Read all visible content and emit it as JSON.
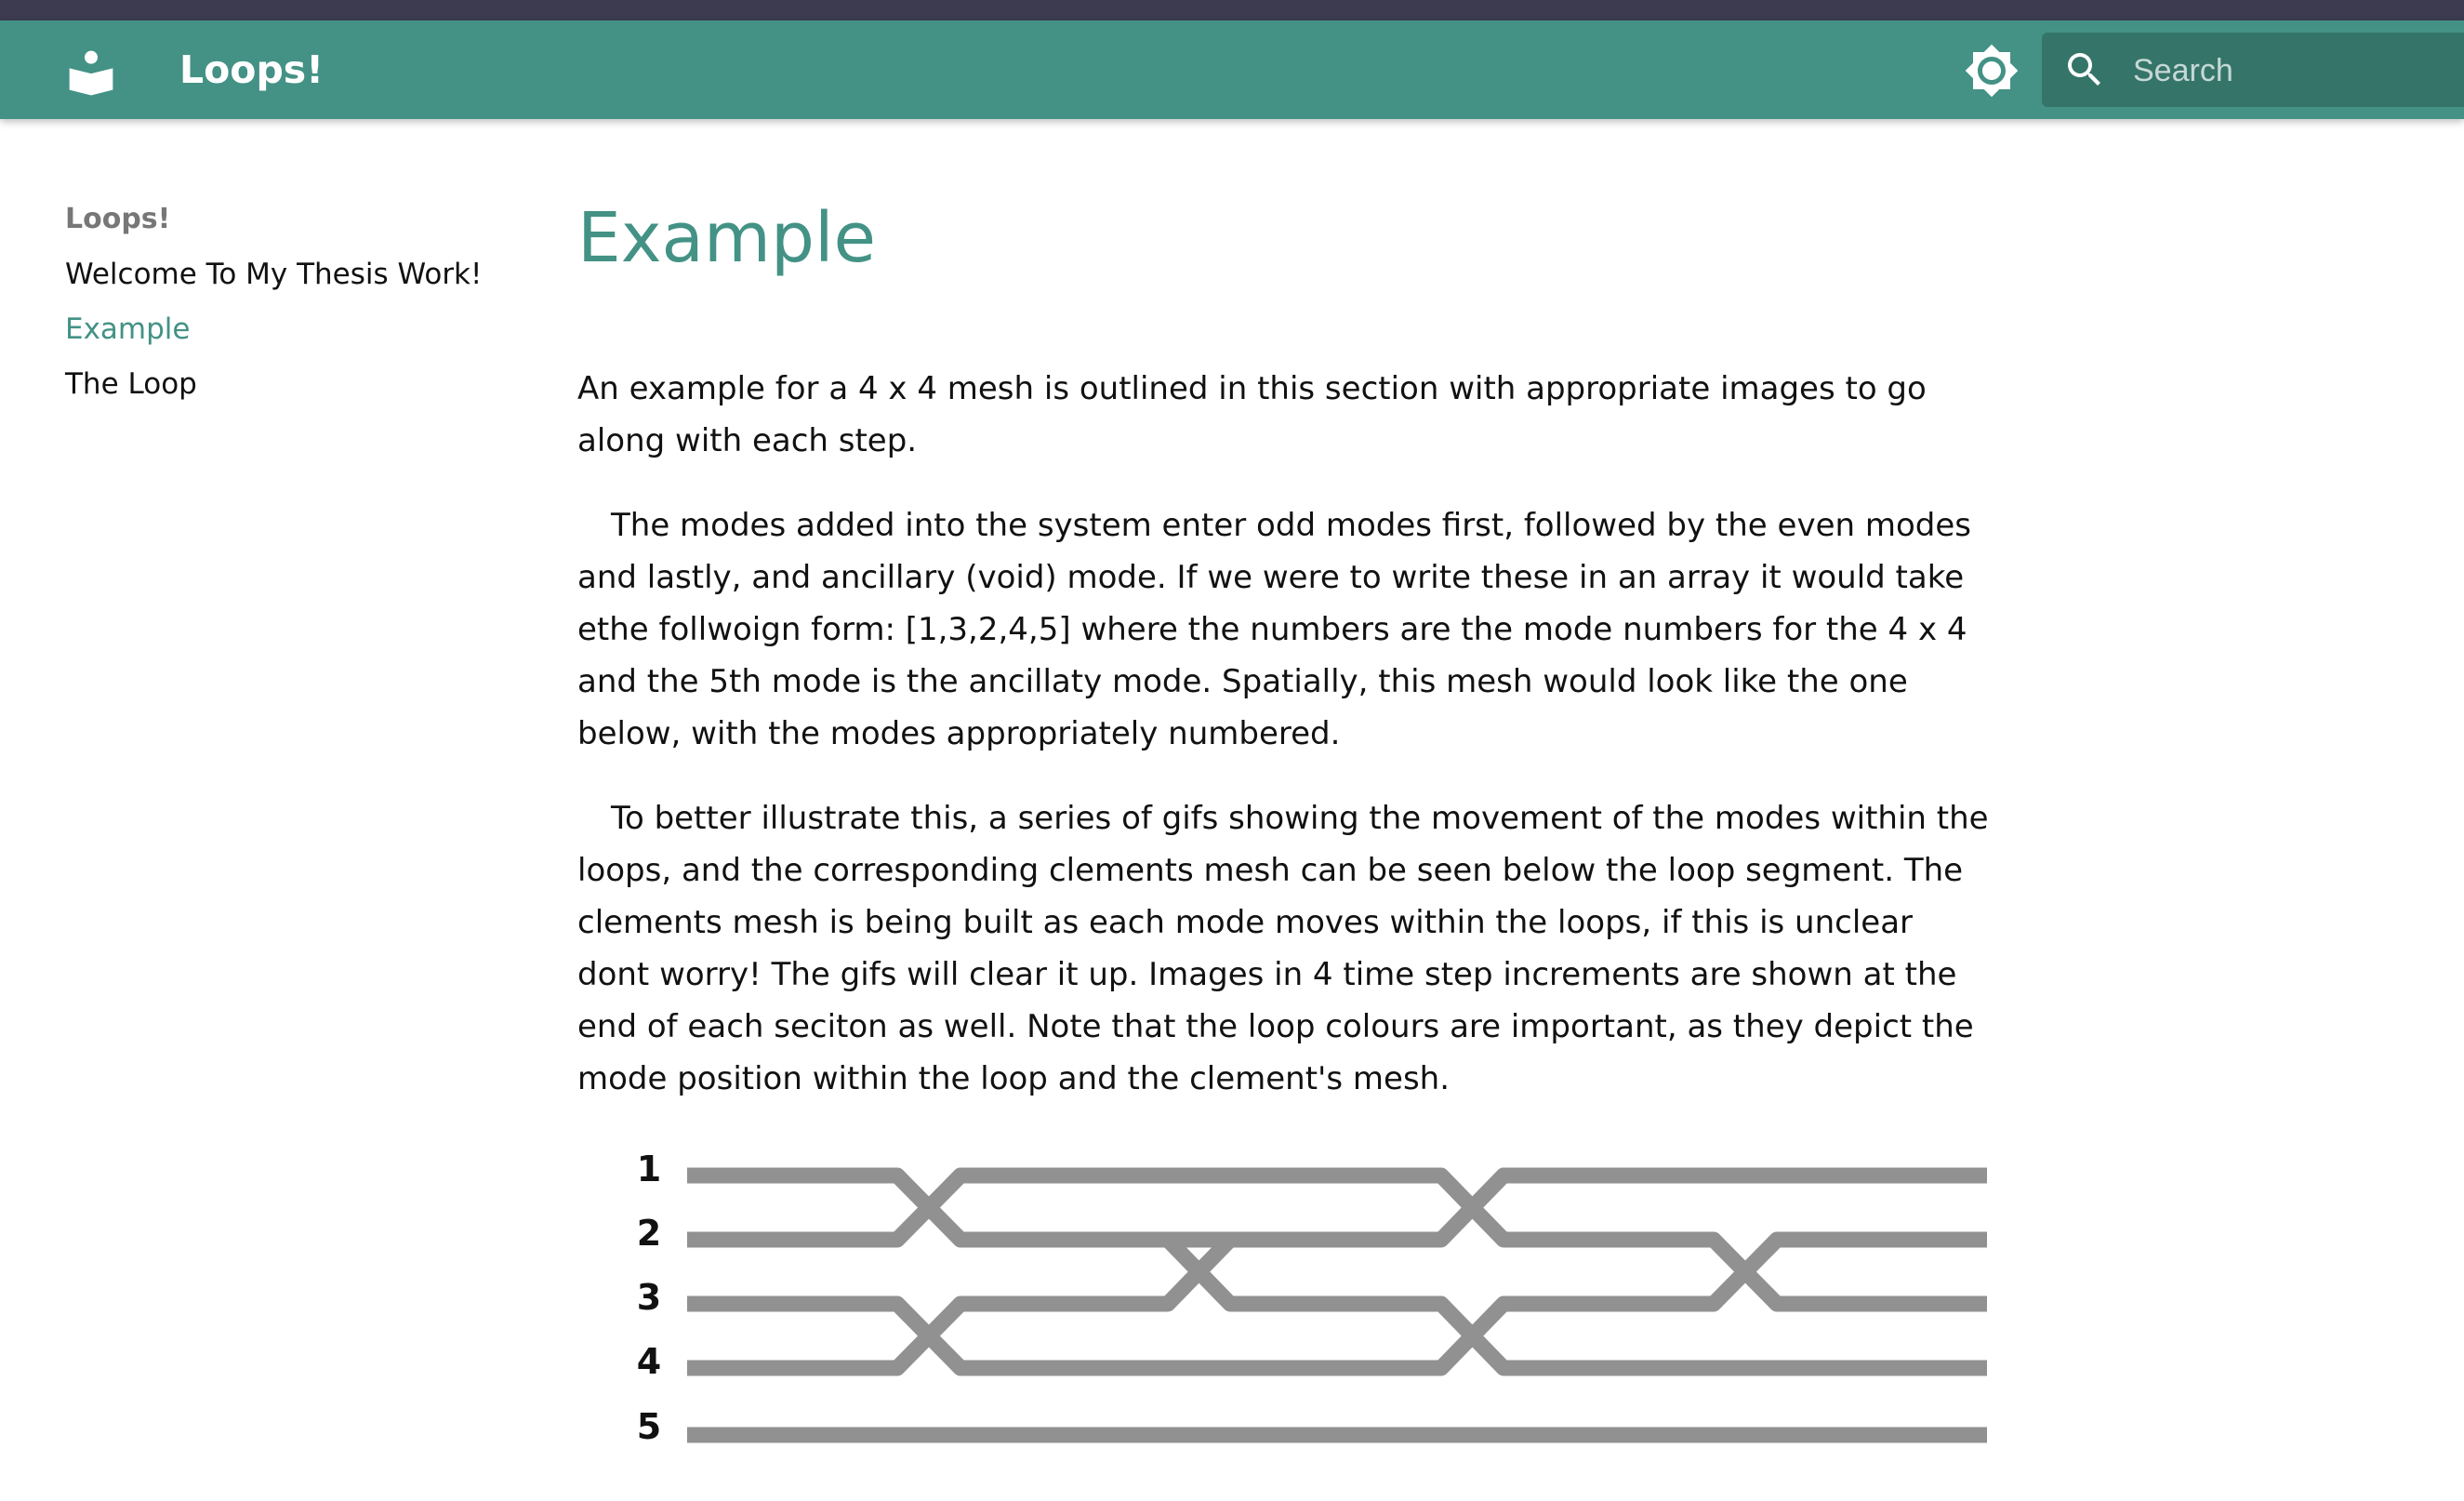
{
  "header": {
    "title": "Loops!",
    "logo_icon": "book-reader-icon",
    "theme_icon": "brightness-icon",
    "search": {
      "placeholder": "Search",
      "icon": "search-icon"
    },
    "colors": {
      "primary": "#439285",
      "top_strip": "#3d3b4f"
    }
  },
  "sidebar": {
    "heading": "Loops!",
    "items": [
      {
        "label": "Welcome To My Thesis Work!",
        "active": false
      },
      {
        "label": "Example",
        "active": true
      },
      {
        "label": "The Loop",
        "active": false
      }
    ]
  },
  "main": {
    "title": "Example",
    "paragraphs": [
      "An example for a 4 x 4 mesh is outlined in this section with appropriate images to go along with each step.",
      "The modes added into the system enter odd modes first, followed by the even modes and lastly, and ancillary (void) mode. If we were to write these in an array it would take ethe follwoign form: [1,3,2,4,5] where the numbers are the mode numbers for the 4 x 4 and the 5th mode is the ancillaty mode. Spatially, this mesh would look like the one below, with the modes appropriately numbered.",
      "To better illustrate this, a series of gifs showing the movement of the modes within the loops, and the corresponding clements mesh can be seen below the loop segment. The clements mesh is being built as each mode moves within the loops, if this is unclear dont worry! The gifs will clear it up. Images in 4 time step increments are shown at the end of each seciton as well. Note that the loop colours are important, as they depict the mode position within the loop and the clement's mesh."
    ],
    "diagram": {
      "mode_labels": [
        "1",
        "2",
        "3",
        "4",
        "5"
      ],
      "line_color": "#919191"
    }
  }
}
